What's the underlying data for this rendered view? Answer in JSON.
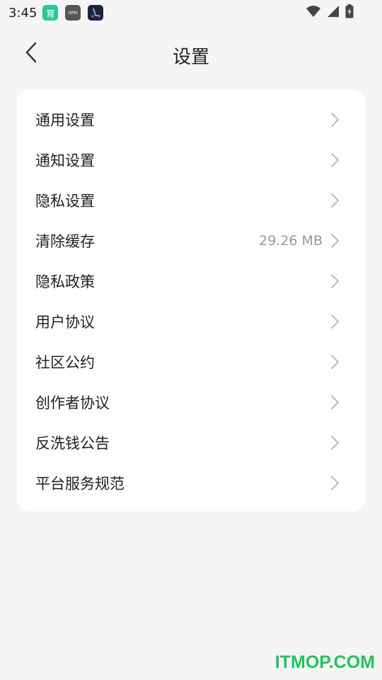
{
  "status_bar": {
    "time": "3:45",
    "apps": [
      {
        "name": "yu-app-icon",
        "glyph": "育"
      },
      {
        "name": "hms-app-icon",
        "glyph": "HMS"
      },
      {
        "name": "scooter-app-icon",
        "glyph": ""
      }
    ]
  },
  "header": {
    "title": "设置"
  },
  "settings": {
    "items": [
      {
        "label": "通用设置",
        "value": ""
      },
      {
        "label": "通知设置",
        "value": ""
      },
      {
        "label": "隐私设置",
        "value": ""
      },
      {
        "label": "清除缓存",
        "value": "29.26 MB"
      },
      {
        "label": "隐私政策",
        "value": ""
      },
      {
        "label": "用户协议",
        "value": ""
      },
      {
        "label": "社区公约",
        "value": ""
      },
      {
        "label": "创作者协议",
        "value": ""
      },
      {
        "label": "反洗钱公告",
        "value": ""
      },
      {
        "label": "平台服务规范",
        "value": ""
      }
    ]
  },
  "watermark": "ITMOP.COM",
  "colors": {
    "background": "#f5f5f5",
    "card": "#ffffff",
    "chevron": "#bbbbbb",
    "secondary_text": "#999999",
    "watermark": "#22c35e"
  }
}
